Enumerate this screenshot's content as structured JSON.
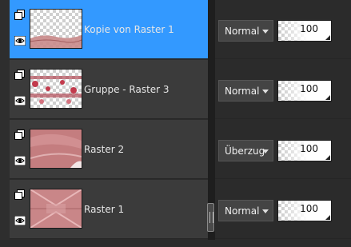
{
  "layers": [
    {
      "name": "Kopie von Raster 1",
      "blend_mode": "Normal",
      "opacity": "100",
      "selected": true,
      "thumb": "layer-thumb-kopie-von-raster-1",
      "group_icon": "layer-group-icon",
      "visibility_icon": "eye-icon"
    },
    {
      "name": "Gruppe - Raster 3",
      "blend_mode": "Normal",
      "opacity": "100",
      "selected": false,
      "thumb": "layer-thumb-gruppe-raster-3",
      "group_icon": "layer-group-icon",
      "visibility_icon": "eye-icon"
    },
    {
      "name": "Raster 2",
      "blend_mode": "Überzug",
      "opacity": "100",
      "selected": false,
      "thumb": "layer-thumb-raster-2",
      "group_icon": "layer-group-icon",
      "visibility_icon": "eye-icon"
    },
    {
      "name": "Raster 1",
      "blend_mode": "Normal",
      "opacity": "100",
      "selected": false,
      "thumb": "layer-thumb-raster-1",
      "group_icon": "layer-group-icon",
      "visibility_icon": "eye-icon"
    }
  ],
  "colors": {
    "selected_row": "#3399ff",
    "row": "#3b3b3b",
    "panel_bg": "#2b2b2b",
    "thumb_pink": "#c98a8a"
  }
}
